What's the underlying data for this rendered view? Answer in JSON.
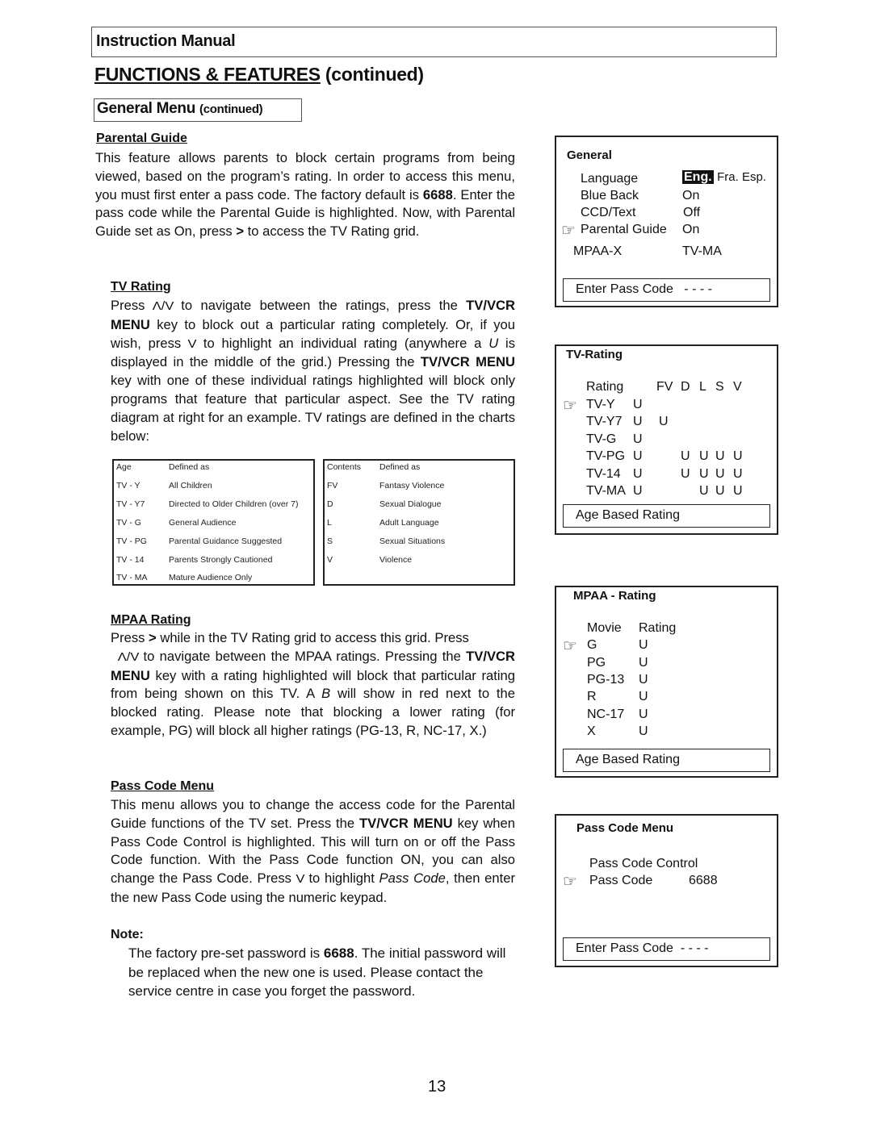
{
  "header": {
    "manual_title": "Instruction Manual",
    "section_title": "FUNCTIONS & FEATURES",
    "section_suffix": "(continued)",
    "subsection_title": "General Menu",
    "subsection_suffix": "(continued)"
  },
  "parental_guide": {
    "heading": "Parental Guide",
    "p1": "This feature allows parents to block certain programs from being viewed, based on the program’s rating. In order to access this menu, you must first enter a pass code. The factory default is ",
    "p1_bold": "6688",
    "p1_end": ".",
    "p2": "Enter the pass code while the Parental Guide is highlighted.  Now, with Parental Guide set as On, press ",
    "p2_key": ">",
    "p2_end": " to access the TV Rating grid."
  },
  "tv_rating": {
    "heading": "TV Rating",
    "t1": "Press ",
    "updown": "Λ/V",
    "t2": " to navigate between the ratings, press the ",
    "key1": "TV/VCR MENU",
    "t3": " key to block out a particular rating completely. Or, if you wish, press ",
    "down": "V",
    "t4": " to highlight an individual rating (anywhere a ",
    "u": "U",
    "t5": " is displayed in the middle of the grid.) Pressing the ",
    "key2": "TV/VCR MENU",
    "t6": " key with one of these individual ratings highlighted will block only programs that feature that particular aspect. See the TV rating diagram at right for an example. TV ratings are defined in the charts below:"
  },
  "age_table": {
    "headers": [
      "Age",
      "Defined as"
    ],
    "rows": [
      [
        "TV - Y",
        "All Children"
      ],
      [
        "TV - Y7",
        "Directed to Older Children (over 7)"
      ],
      [
        "TV - G",
        "General Audience"
      ],
      [
        "TV - PG",
        "Parental Guidance Suggested"
      ],
      [
        "TV - 14",
        "Parents Strongly Cautioned"
      ],
      [
        "TV - MA",
        "Mature Audience Only"
      ]
    ]
  },
  "contents_table": {
    "headers": [
      "Contents",
      "Defined as"
    ],
    "rows": [
      [
        "FV",
        "Fantasy Violence"
      ],
      [
        "D",
        "Sexual Dialogue"
      ],
      [
        "L",
        "Adult Language"
      ],
      [
        "S",
        "Sexual Situations"
      ],
      [
        "V",
        "Violence"
      ]
    ]
  },
  "mpaa_rating": {
    "heading": "MPAA Rating",
    "t1": "Press ",
    "key": ">",
    "t2": " while in the TV Rating grid to access this grid. Press",
    "updown": "Λ/V",
    "t3": "  to navigate between the MPAA ratings. Pressing the ",
    "key1": "TV/VCR MENU",
    "t4": " key with a rating highlighted will block that particular rating from being shown on this TV. A ",
    "b": "B",
    "t5": " will show in red next to the blocked rating. Please note that blocking a lower rating (for example, PG) will block all higher ratings (PG-13, R, NC-17, X.)"
  },
  "pass_code_section": {
    "heading": "Pass Code Menu",
    "t1": "This menu allows you to change the access code for the Parental Guide functions of the TV set. Press the ",
    "key1": "TV/VCR MENU",
    "t2": " key when Pass Code Control is highlighted. This will turn on or off the Pass Code function. With the Pass Code function ON, you can also change the Pass Code. Press ",
    "down": "V",
    "t3": " to highlight ",
    "italic": "Pass Code",
    "t4": ", then enter the new Pass Code using the numeric keypad."
  },
  "note": {
    "label": "Note:",
    "t1": "The factory pre-set password is ",
    "bold": "6688",
    "t2": ". The initial password will be replaced when the new one is used. Please contact the service centre in case you forget the password."
  },
  "osd_general": {
    "title": "General",
    "rows": [
      {
        "label": "Language",
        "value_selected": "Eng.",
        "value_rest": "Fra. Esp."
      },
      {
        "label": "Blue Back",
        "value": "On"
      },
      {
        "label": "CCD/Text",
        "value": "Off"
      },
      {
        "label": "Parental Guide",
        "value": "On",
        "pointer": true
      }
    ],
    "extra_label": "MPAA-X",
    "extra_value": "TV-MA",
    "footer_label": "Enter Pass Code",
    "footer_value": "- - - -"
  },
  "osd_tv_rating": {
    "title": "TV-Rating",
    "headers": [
      "Rating",
      "FV",
      "D",
      "L",
      "S",
      "V"
    ],
    "rows": [
      {
        "rating": "TV-Y",
        "age": "U",
        "cells": [
          "",
          "",
          "",
          "",
          ""
        ],
        "pointer": true
      },
      {
        "rating": "TV-Y7",
        "age": "U",
        "cells": [
          "U",
          "",
          "",
          "",
          ""
        ]
      },
      {
        "rating": "TV-G",
        "age": "U",
        "cells": [
          "",
          "",
          "",
          "",
          ""
        ]
      },
      {
        "rating": "TV-PG",
        "age": "U",
        "cells": [
          "",
          "U",
          "U",
          "U",
          "U"
        ]
      },
      {
        "rating": "TV-14",
        "age": "U",
        "cells": [
          "",
          "U",
          "U",
          "U",
          "U"
        ]
      },
      {
        "rating": "TV-MA",
        "age": "U",
        "cells": [
          "",
          "",
          "U",
          "U",
          "U"
        ]
      }
    ],
    "footer": "Age Based Rating"
  },
  "osd_mpaa": {
    "title": "MPAA - Rating",
    "headers": [
      "Movie",
      "Rating"
    ],
    "rows": [
      {
        "movie": "G",
        "rating": "U",
        "pointer": true
      },
      {
        "movie": "PG",
        "rating": "U"
      },
      {
        "movie": "PG-13",
        "rating": "U"
      },
      {
        "movie": "R",
        "rating": "U"
      },
      {
        "movie": "NC-17",
        "rating": "U"
      },
      {
        "movie": "X",
        "rating": "U"
      }
    ],
    "footer": "Age Based Rating"
  },
  "osd_pass_code": {
    "title": "Pass Code Menu",
    "row1_label": "Pass Code Control",
    "row2_label": "Pass Code",
    "row2_value": "6688",
    "footer_label": "Enter Pass Code",
    "footer_value": "- - - -"
  },
  "icons": {
    "pointer": "☞"
  },
  "page_number": "13"
}
